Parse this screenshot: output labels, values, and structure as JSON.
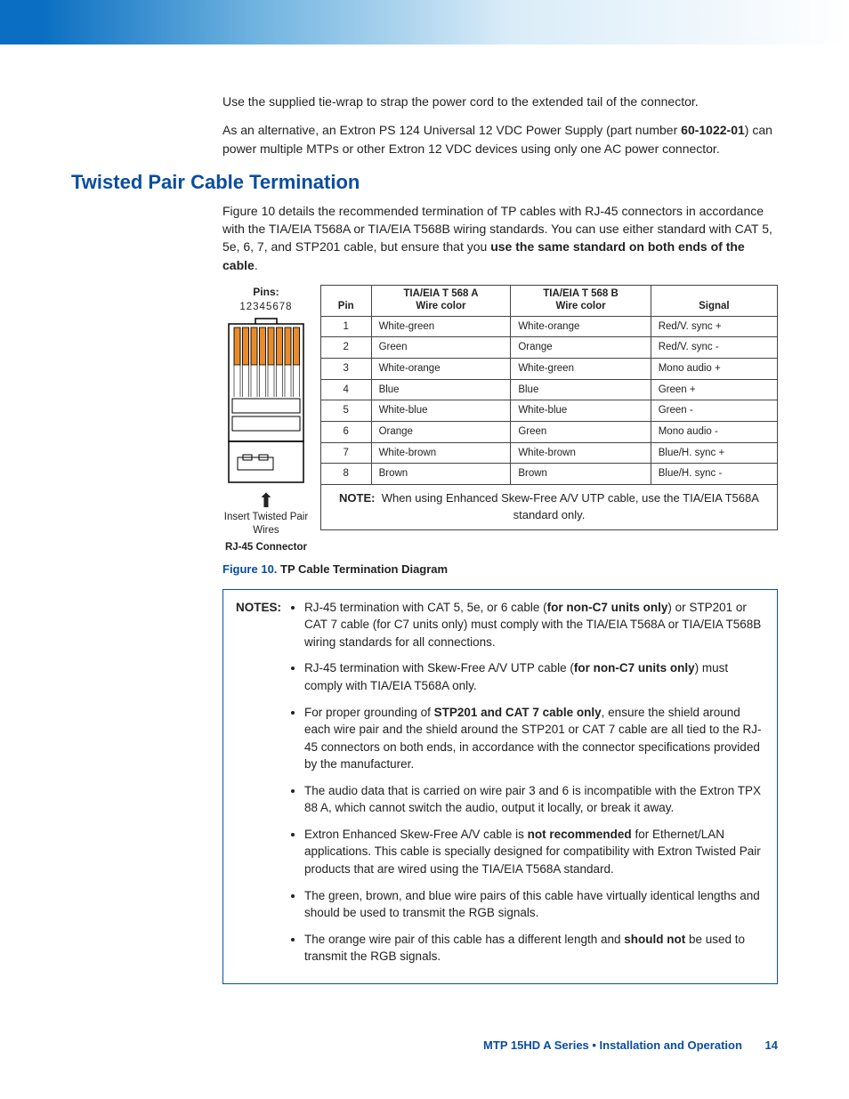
{
  "intro": {
    "p1": "Use the supplied tie-wrap to strap the power cord to the extended tail of the connector.",
    "p2a": "As an alternative, an Extron PS 124 Universal 12 VDC Power Supply (part number ",
    "p2b": "60-1022-01",
    "p2c": ") can power multiple MTPs or other Extron 12 VDC devices using only one AC power connector."
  },
  "section_title": "Twisted Pair Cable Termination",
  "section_intro_a": "Figure 10 details the recommended termination of TP cables with RJ-45 connectors in accordance with the TIA/EIA T568A or TIA/EIA T568B wiring standards. You can use either standard with CAT 5, 5e, 6, 7, and STP201 cable, but ensure that you ",
  "section_intro_b": "use the same standard on both ends of the cable",
  "section_intro_c": ".",
  "rj45": {
    "pins_label": "Pins:",
    "pins_digits": "12345678",
    "insert": "Insert Twisted Pair Wires",
    "connector": "RJ-45 Connector"
  },
  "table": {
    "h_pin": "Pin",
    "h_a_top": "TIA/EIA T 568 A",
    "h_a_bot": "Wire color",
    "h_b_top": "TIA/EIA T 568 B",
    "h_b_bot": "Wire color",
    "h_sig": "Signal",
    "rows": [
      {
        "pin": "1",
        "a": "White-green",
        "b": "White-orange",
        "s": "Red/V. sync +"
      },
      {
        "pin": "2",
        "a": "Green",
        "b": "Orange",
        "s": "Red/V. sync -"
      },
      {
        "pin": "3",
        "a": "White-orange",
        "b": "White-green",
        "s": "Mono audio +"
      },
      {
        "pin": "4",
        "a": "Blue",
        "b": "Blue",
        "s": "Green +"
      },
      {
        "pin": "5",
        "a": "White-blue",
        "b": "White-blue",
        "s": "Green -"
      },
      {
        "pin": "6",
        "a": "Orange",
        "b": "Green",
        "s": "Mono audio -"
      },
      {
        "pin": "7",
        "a": "White-brown",
        "b": "White-brown",
        "s": "Blue/H. sync +"
      },
      {
        "pin": "8",
        "a": "Brown",
        "b": "Brown",
        "s": "Blue/H. sync -"
      }
    ],
    "note_lead": "NOTE:",
    "note_text": "When using Enhanced Skew-Free A/V UTP cable, use the TIA/EIA T568A standard only."
  },
  "figcap": {
    "lead": "Figure 10.",
    "text": " TP Cable Termination Diagram"
  },
  "notes": {
    "label": "NOTES:",
    "items": [
      {
        "pre": "RJ-45 termination with CAT 5, 5e, or 6 cable (",
        "bold": "for non-C7 units only",
        "post": ") or STP201 or CAT 7 cable (for C7 units only) must comply with the TIA/EIA T568A or TIA/EIA T568B wiring standards for all connections."
      },
      {
        "pre": "RJ-45 termination with Skew-Free A/V UTP cable (",
        "bold": "for non-C7 units only",
        "post": ") must comply with TIA/EIA T568A only."
      },
      {
        "pre": "For proper grounding of ",
        "bold": "STP201 and CAT 7 cable only",
        "post": ", ensure the shield around each wire pair and the shield around the STP201 or CAT 7 cable are all tied to the RJ-45 connectors on both ends, in accordance with the connector specifications provided by the manufacturer."
      },
      {
        "pre": "The audio data that is carried on wire pair 3 and 6 is incompatible with the Extron TPX 88 A, which cannot switch the audio, output it locally, or break it away.",
        "bold": "",
        "post": ""
      },
      {
        "pre": "Extron Enhanced Skew-Free A/V cable is ",
        "bold": "not recommended",
        "post": " for Ethernet/LAN applications. This cable is specially designed for compatibility with Extron Twisted Pair products that are wired using the TIA/EIA T568A standard."
      },
      {
        "pre": "The green, brown, and blue wire pairs of this cable have virtually identical lengths and should be used to transmit the RGB signals.",
        "bold": "",
        "post": ""
      },
      {
        "pre": "The orange wire pair of this cable has a different length and ",
        "bold": "should not",
        "post": " be used to transmit the RGB signals."
      }
    ]
  },
  "footer": {
    "text": "MTP 15HD A Series • Installation and Operation",
    "page": "14"
  }
}
